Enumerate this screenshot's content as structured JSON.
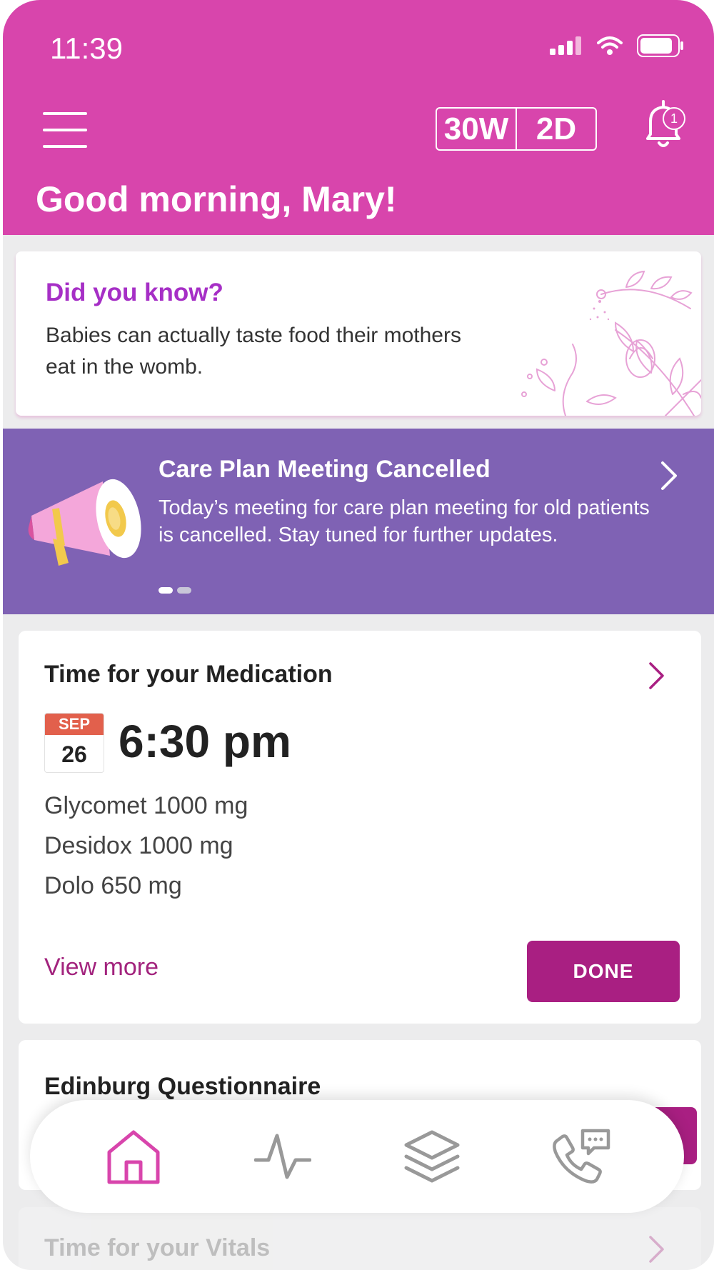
{
  "status_bar": {
    "time": "11:39"
  },
  "header": {
    "weeks": "30W",
    "days": "2D",
    "notification_count": "1",
    "greeting": "Good morning, Mary!"
  },
  "did_you_know": {
    "title": "Did you know?",
    "text": "Babies can actually taste food their mothers eat in the womb."
  },
  "announcement": {
    "title": "Care Plan Meeting Cancelled",
    "text": "Today’s meeting for care plan meeting for old patients is cancelled. Stay tuned for further updates.",
    "page_index": 1,
    "page_count": 2
  },
  "medication": {
    "title": "Time for your Medication",
    "month": "SEP",
    "day": "26",
    "time": "6:30 pm",
    "drugs": [
      "Glycomet 1000 mg",
      "Desidox 1000 mg",
      "Dolo 650 mg"
    ],
    "view_more": "View more",
    "done": "DONE"
  },
  "questionnaire": {
    "title": "Edinburg Questionnaire"
  },
  "vitals": {
    "title": "Time for your Vitals"
  },
  "bottom_nav": {
    "items": [
      {
        "icon": "home-icon",
        "active": true
      },
      {
        "icon": "pulse-icon",
        "active": false
      },
      {
        "icon": "layers-icon",
        "active": false
      },
      {
        "icon": "phone-chat-icon",
        "active": false
      }
    ]
  },
  "colors": {
    "header": "#d845ac",
    "accent": "#a91f82",
    "announcement": "#7f62b4",
    "title_purple": "#a62fc6",
    "calendar_red": "#e2604c"
  }
}
